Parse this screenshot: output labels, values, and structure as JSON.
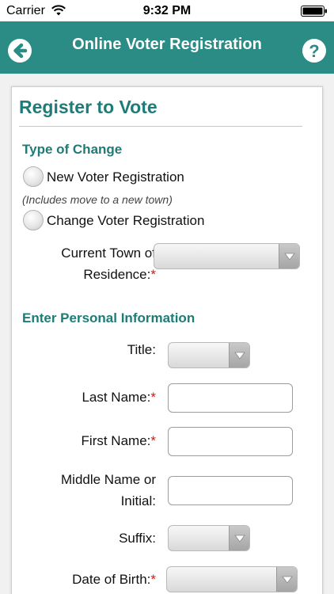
{
  "status_bar": {
    "carrier": "Carrier",
    "time": "9:32 PM"
  },
  "nav": {
    "title": "Online Voter Registration",
    "back_icon": "back-arrow-icon",
    "help_icon": "help-icon"
  },
  "colors": {
    "nav_background": "#2a8c85",
    "heading_text": "#1f7b77",
    "required_marker": "#d01818"
  },
  "form": {
    "title": "Register to Vote",
    "type_of_change": {
      "heading": "Type of Change",
      "options": [
        {
          "label": "New Voter Registration",
          "selected": false
        },
        {
          "label": "Change Voter Registration",
          "selected": false
        }
      ],
      "new_hint": "(Includes move to a new town)",
      "current_town": {
        "label_line1": "Current Town of",
        "label_line2": "Residence:",
        "required": "*",
        "value": ""
      }
    },
    "personal_info": {
      "heading": "Enter Personal Information",
      "title_field": {
        "label": "Title:",
        "value": ""
      },
      "last_name": {
        "label": "Last Name:",
        "required": "*",
        "value": ""
      },
      "first_name": {
        "label": "First Name:",
        "required": "*",
        "value": ""
      },
      "middle_name": {
        "label_line1": "Middle Name or",
        "label_line2": "Initial:",
        "value": ""
      },
      "suffix": {
        "label": "Suffix:",
        "value": ""
      },
      "date_of_birth": {
        "label": "Date of Birth:",
        "required": "*",
        "value": ""
      }
    }
  }
}
